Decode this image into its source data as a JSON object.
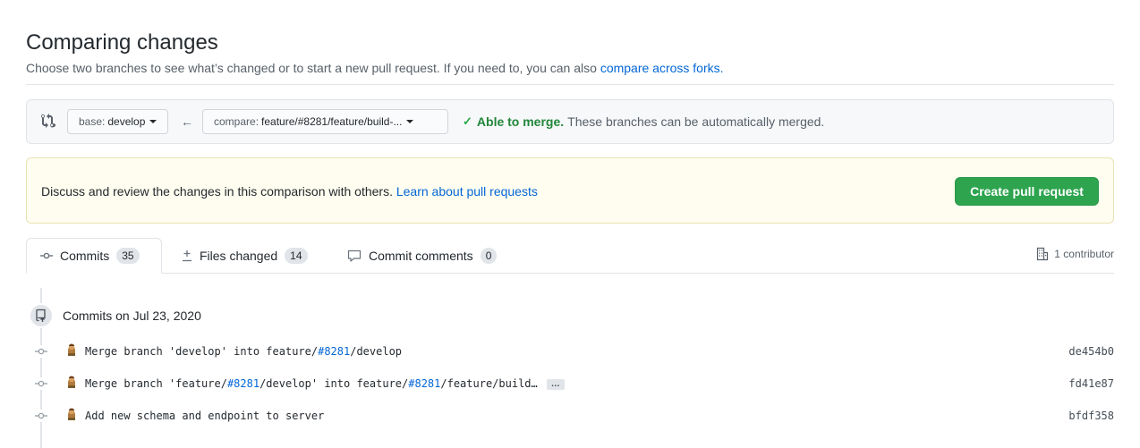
{
  "header": {
    "title": "Comparing changes",
    "description": "Choose two branches to see what’s changed or to start a new pull request. If you need to, you can also ",
    "forks_link": "compare across forks."
  },
  "range": {
    "base_prefix": "base:",
    "base_value": "develop",
    "compare_prefix": "compare:",
    "compare_value": "feature/#8281/feature/build-...",
    "merge_ok": "Able to merge.",
    "merge_text": "These branches can be automatically merged."
  },
  "pr_box": {
    "text": "Discuss and review the changes in this comparison with others. ",
    "link": "Learn about pull requests",
    "button": "Create pull request"
  },
  "tabs": [
    {
      "label": "Commits",
      "count": "35"
    },
    {
      "label": "Files changed",
      "count": "14"
    },
    {
      "label": "Commit comments",
      "count": "0"
    }
  ],
  "contributors": "1 contributor",
  "commit_group": {
    "title": "Commits on Jul 23, 2020",
    "commits": [
      {
        "parts": [
          [
            "Merge branch 'develop' into feature/",
            false
          ],
          [
            "#8281",
            true
          ],
          [
            "/develop",
            false
          ]
        ],
        "sha": "de454b0"
      },
      {
        "parts": [
          [
            "Merge branch 'feature/",
            false
          ],
          [
            "#8281",
            true
          ],
          [
            "/develop' into feature/",
            false
          ],
          [
            "#8281",
            true
          ],
          [
            "/feature/build…",
            false
          ]
        ],
        "sha": "fd41e87",
        "ellipsis": "…"
      },
      {
        "parts": [
          [
            "Add new schema and endpoint to server",
            false
          ]
        ],
        "sha": "bfdf358"
      }
    ]
  },
  "colors": {
    "link": "#0366d6",
    "merge_green": "#22863a",
    "button_green": "#2ea44f",
    "pr_box_bg": "#fffdef"
  }
}
